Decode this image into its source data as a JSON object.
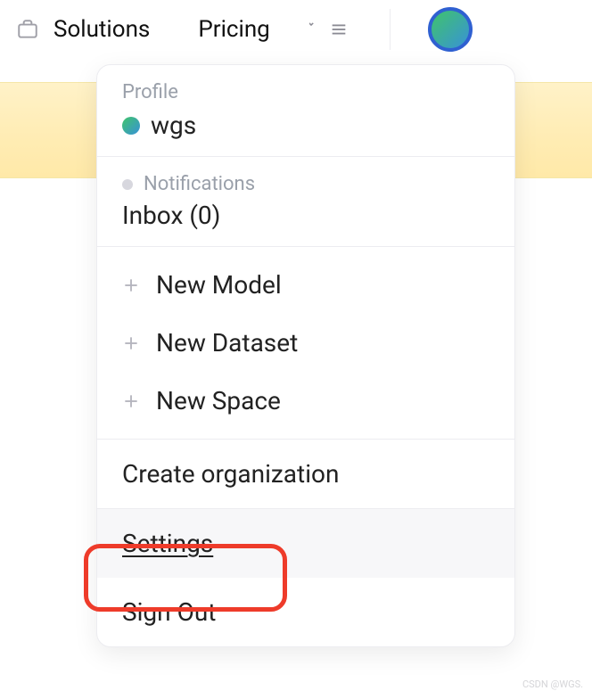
{
  "nav": {
    "solutions": "Solutions",
    "pricing": "Pricing"
  },
  "dropdown": {
    "profile": {
      "label": "Profile",
      "username": "wgs"
    },
    "notifications": {
      "label": "Notifications",
      "inbox_label": "Inbox",
      "inbox_count": 0
    },
    "new_items": [
      {
        "label": "New Model"
      },
      {
        "label": "New Dataset"
      },
      {
        "label": "New Space"
      }
    ],
    "create_org": "Create organization",
    "settings": "Settings",
    "sign_out": "Sign Out"
  },
  "watermark": "CSDN @WGS."
}
